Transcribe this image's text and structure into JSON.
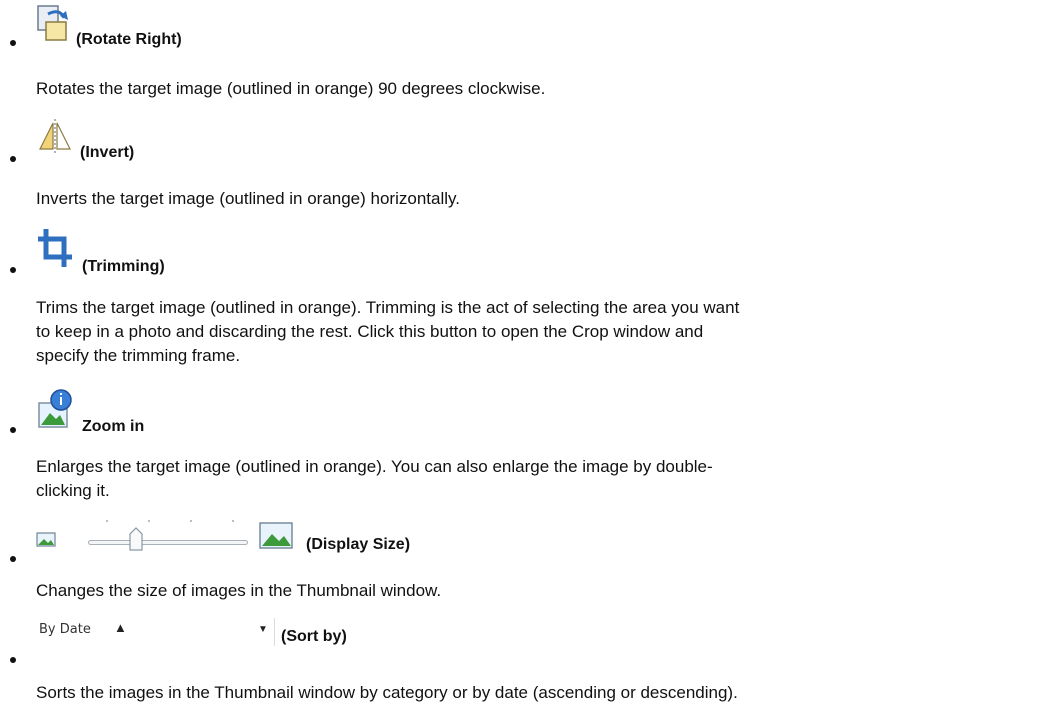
{
  "items": [
    {
      "icon": "rotate-right-icon",
      "label": "(Rotate Right)",
      "description": "Rotates the target image (outlined in orange) 90 degrees clockwise."
    },
    {
      "icon": "invert-icon",
      "label": "(Invert)",
      "description": "Inverts the target image (outlined in orange) horizontally."
    },
    {
      "icon": "trimming-icon",
      "label": "(Trimming)",
      "description_lines": [
        "Trims the target image (outlined in orange). Trimming is the act of selecting the area you want",
        "to keep in a photo and discarding the rest. Click this button to open the Crop window and",
        "specify the trimming frame."
      ]
    },
    {
      "icon": "zoom-in-icon",
      "label": "Zoom in",
      "description_lines": [
        "Enlarges the target image (outlined in orange). You can also enlarge the image by double-",
        "clicking it."
      ]
    },
    {
      "icon": "display-size-slider",
      "label": "(Display Size)",
      "description": "Changes the size of images in the Thumbnail window."
    },
    {
      "icon": "sort-dropdown",
      "label": "(Sort by)",
      "select_value": "By Date",
      "select_direction": "▲",
      "description": "Sorts the images in the Thumbnail window by category or by date (ascending or descending)."
    }
  ],
  "colors": {
    "text": "#111111",
    "icon_blue": "#2f6fbf",
    "icon_yellow": "#f2d37a",
    "icon_green": "#3c9a3a"
  }
}
